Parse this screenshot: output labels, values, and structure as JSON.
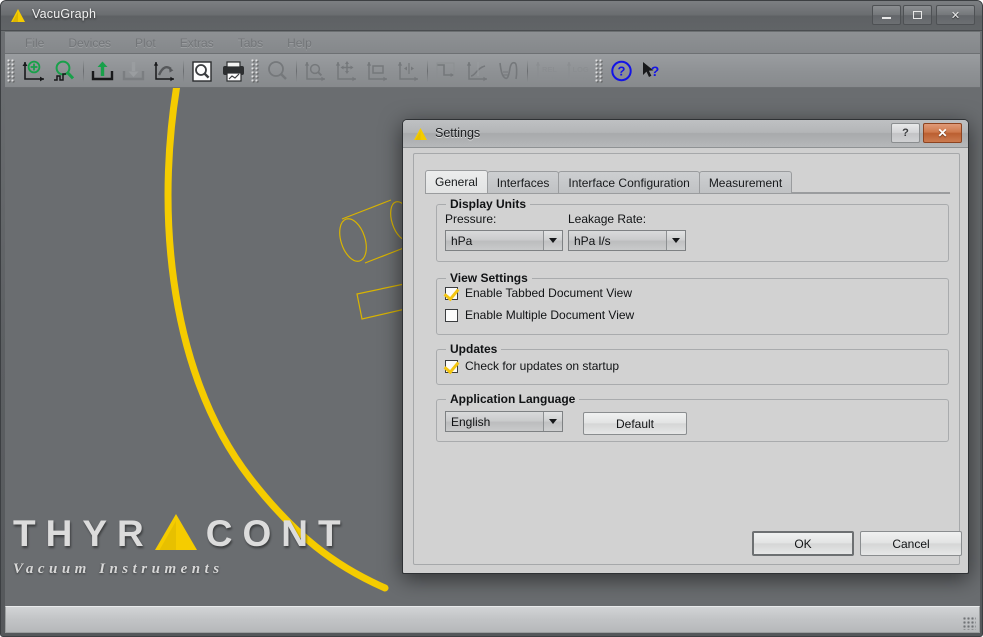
{
  "window": {
    "title": "VacuGraph",
    "icon": "thyracont-triangle-icon",
    "minimize_label": "",
    "maximize_label": "",
    "close_label": "✕"
  },
  "menubar": {
    "items": [
      {
        "label": "File"
      },
      {
        "label": "Devices"
      },
      {
        "label": "Plot"
      },
      {
        "label": "Extras"
      },
      {
        "label": "Tabs"
      },
      {
        "label": "Help"
      }
    ]
  },
  "toolbar": {
    "groups": [
      {
        "buttons": [
          {
            "icon": "new-plot-icon",
            "enabled": true
          },
          {
            "icon": "zoom-search-plot-icon",
            "enabled": true
          },
          {
            "icon": "open-upload-icon",
            "enabled": true
          },
          {
            "icon": "save-download-icon",
            "enabled": false
          },
          {
            "icon": "export-plot-icon",
            "enabled": true
          },
          {
            "icon": "print-preview-icon",
            "enabled": true
          },
          {
            "icon": "print-icon",
            "enabled": true
          }
        ]
      },
      {
        "buttons": [
          {
            "icon": "zoom-icon",
            "enabled": false
          },
          {
            "icon": "zoom-axis-icon",
            "enabled": false
          },
          {
            "icon": "pan-move-icon",
            "enabled": false
          },
          {
            "icon": "zoom-rect-icon",
            "enabled": false
          },
          {
            "icon": "zoom-horizontal-icon",
            "enabled": false
          },
          {
            "icon": "curve-step-icon",
            "enabled": false
          },
          {
            "icon": "curve-slope-icon",
            "enabled": false
          },
          {
            "icon": "curve-marker-icon",
            "enabled": false
          },
          {
            "icon": "rel-axis-icon",
            "enabled": false,
            "text": "REL"
          },
          {
            "icon": "log-axis-icon",
            "enabled": false,
            "text": "LOG"
          }
        ]
      },
      {
        "buttons": [
          {
            "icon": "help-circle-icon",
            "enabled": true
          },
          {
            "icon": "whats-this-icon",
            "enabled": true
          }
        ]
      }
    ]
  },
  "branding": {
    "logo_letters": [
      "T",
      "H",
      "Y",
      "R",
      "▲",
      "C",
      "O",
      "N",
      "T"
    ],
    "logo_text": "THYRACONT",
    "tagline": "Vacuum Instruments",
    "accent_color": "#f5cc00",
    "letter_color": "#dcdcdc"
  },
  "statusbar": {
    "text": ""
  },
  "dialog": {
    "title": "Settings",
    "icon": "thyracont-triangle-icon",
    "help_button_label": "?",
    "close_button_label": "✕",
    "tabs": [
      {
        "label": "General",
        "active": true
      },
      {
        "label": "Interfaces",
        "active": false
      },
      {
        "label": "Interface Configuration",
        "active": false
      },
      {
        "label": "Measurement",
        "active": false
      }
    ],
    "display_units": {
      "title": "Display Units",
      "pressure_label": "Pressure:",
      "pressure_value": "hPa",
      "leakage_label": "Leakage Rate:",
      "leakage_value": "hPa l/s"
    },
    "view_settings": {
      "title": "View Settings",
      "options": [
        {
          "label": "Enable Tabbed Document View",
          "checked": true
        },
        {
          "label": "Enable Multiple Document View",
          "checked": false
        }
      ]
    },
    "updates": {
      "title": "Updates",
      "options": [
        {
          "label": "Check for updates on startup",
          "checked": true
        }
      ]
    },
    "application_language": {
      "title": "Application Language",
      "value": "English",
      "default_button": "Default"
    },
    "ok_label": "OK",
    "cancel_label": "Cancel"
  }
}
